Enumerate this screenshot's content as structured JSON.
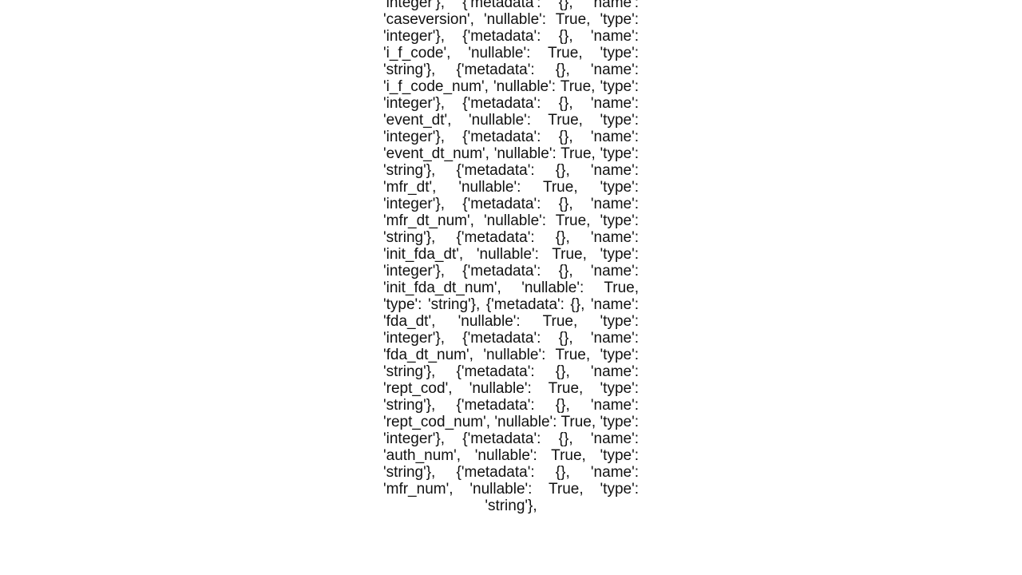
{
  "schema_text": "'name': 'caseid', 'nullable': True, 'type': 'integer'}, {'metadata': {}, 'name': 'caseversion', 'nullable': True, 'type': 'integer'}, {'metadata': {}, 'name': 'i_f_code', 'nullable': True, 'type': 'string'}, {'metadata': {}, 'name': 'i_f_code_num', 'nullable': True, 'type': 'integer'}, {'metadata': {}, 'name': 'event_dt', 'nullable': True, 'type': 'integer'}, {'metadata': {}, 'name': 'event_dt_num', 'nullable': True, 'type': 'string'}, {'metadata': {}, 'name': 'mfr_dt', 'nullable': True, 'type': 'integer'}, {'metadata': {}, 'name': 'mfr_dt_num', 'nullable': True, 'type': 'string'}, {'metadata': {}, 'name': 'init_fda_dt', 'nullable': True, 'type': 'integer'}, {'metadata': {}, 'name': 'init_fda_dt_num', 'nullable': True, 'type': 'string'}, {'metadata': {}, 'name': 'fda_dt', 'nullable': True, 'type': 'integer'}, {'metadata': {}, 'name': 'fda_dt_num', 'nullable': True, 'type': 'string'}, {'metadata': {}, 'name': 'rept_cod', 'nullable': True, 'type': 'string'}, {'metadata': {}, 'name': 'rept_cod_num', 'nullable': True, 'type': 'integer'}, {'metadata': {}, 'name': 'auth_num', 'nullable': True, 'type': 'string'}, {'metadata': {}, 'name': 'mfr_num', 'nullable': True, 'type': 'string'},"
}
